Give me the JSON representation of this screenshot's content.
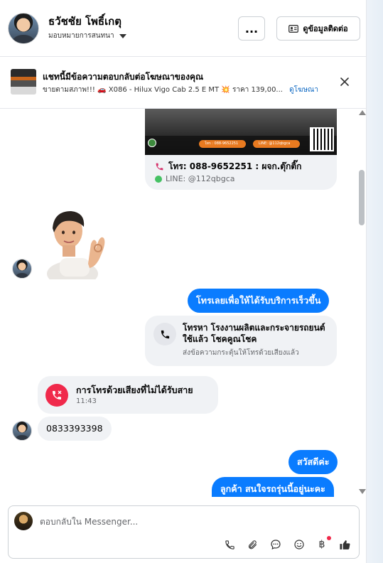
{
  "header": {
    "contact_name": "ธวัชชัย โพธิ์เกตุ",
    "assignment": "มอบหมายการสนทนา",
    "more_label": "...",
    "contact_info_label": "ดูข้อมูลติดต่อ"
  },
  "ad_banner": {
    "title": "แชทนี้มีข้อความตอบกลับต่อโฆษณาของคุณ",
    "description": "ขายตามสภาพ!!! 🚗 X086 - Hilux Vigo Cab 2.5 E MT 💥 ราคา 139,00...",
    "view_ad_link": "ดูโฆษณา"
  },
  "messages": {
    "ad_card": {
      "image_phone": "โทร : 088-9652251",
      "image_line": "LINE: @112qbgca",
      "phone_text": "โทร: 088-9652251 : ผจก.ตุ๊กติ๊ก",
      "line_text": "LINE: @112qbgca"
    },
    "out_call_prompt": "โทรเลยเพื่อให้ได้รับบริการเร็วขึ้น",
    "call_card": {
      "title": "โทรหา โรงงานผลิตและกระจายรถยนต์ใช้แล้ว โชคคูณโชค",
      "subtitle": "ส่งข้อความกระตุ้นให้โทรด้วยเสียงแล้ว"
    },
    "missed_call": {
      "title": "การโทรด้วยเสียงที่ไม่ได้รับสาย",
      "time": "11:43"
    },
    "in_phone_number": "0833393398",
    "out_greeting": "สวัสดีค่ะ",
    "out_question": "ลูกค้า สนใจรถรุ่นนี้อยู่นะคะ"
  },
  "composer": {
    "placeholder": "ตอบกลับใน Messenger...",
    "currency_symbol": "฿"
  },
  "colors": {
    "outgoing_bubble": "#0a7cff",
    "incoming_bubble": "#f0f2f5",
    "missed_call_red": "#f0294b",
    "link_blue": "#0a66c2"
  },
  "icons": [
    "caret-down-icon",
    "contact-card-icon",
    "close-icon",
    "phone-icon",
    "line-icon",
    "missed-call-icon",
    "attach-icon",
    "chat-bubble-icon",
    "emoji-icon",
    "baht-icon",
    "thumbs-up-icon"
  ]
}
